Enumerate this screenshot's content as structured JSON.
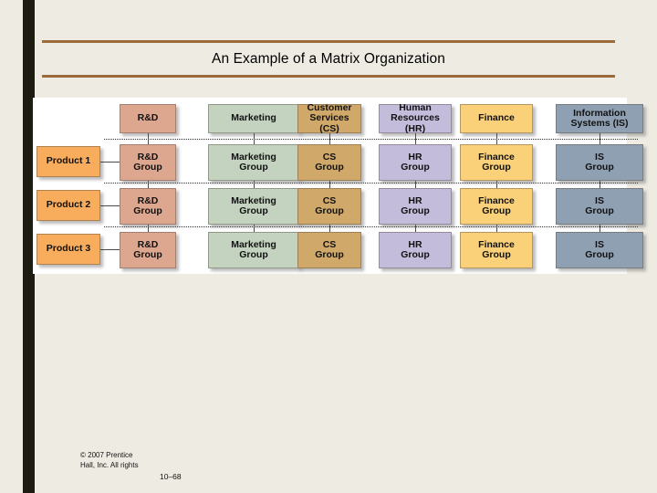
{
  "slide": {
    "title": "An Example of a Matrix Organization",
    "accent_rule_color": "#9c6b3c",
    "background_color": "#eeece2",
    "left_bar_color": "#1c1c10",
    "panel_color": "#ffffff"
  },
  "footer": {
    "copyright": "© 2007 Prentice Hall, Inc. All rights",
    "slide_number": "10–68"
  },
  "matrix": {
    "columns": [
      {
        "id": "rd",
        "header": "R&D",
        "color": "#dda68f",
        "group": "R&D\nGroup",
        "group_line1": "R&D",
        "group_line2": "Group"
      },
      {
        "id": "marketing",
        "header": "Marketing",
        "color": "#c3d3bf",
        "group": "Marketing\nGroup",
        "group_line1": "Marketing",
        "group_line2": "Group"
      },
      {
        "id": "cs",
        "header": "Customer\nServices (CS)",
        "color": "#cfa86a",
        "group": "CS\nGroup",
        "group_line1": "CS",
        "group_line2": "Group"
      },
      {
        "id": "hr",
        "header": "Human\nResources (HR)",
        "color": "#c3bcda",
        "group": "HR\nGroup",
        "group_line1": "HR",
        "group_line2": "Group"
      },
      {
        "id": "finance",
        "header": "Finance",
        "color": "#fad179",
        "group": "Finance\nGroup",
        "group_line1": "Finance",
        "group_line2": "Group"
      },
      {
        "id": "is",
        "header": "Information\nSystems (IS)",
        "color": "#8fa0b3",
        "group": "IS\nGroup",
        "group_line1": "IS",
        "group_line2": "Group"
      }
    ],
    "rows": [
      {
        "id": "product1",
        "label": "Product 1",
        "color": "#f7ad5c"
      },
      {
        "id": "product2",
        "label": "Product 2",
        "color": "#f7ad5c"
      },
      {
        "id": "product3",
        "label": "Product 3",
        "color": "#f7ad5c"
      }
    ],
    "header_labels": {
      "rd_line1": "R&D",
      "marketing_line1": "Marketing",
      "cs_line1": "Customer",
      "cs_line2": "Services (CS)",
      "hr_line1": "Human",
      "hr_line2": "Resources (HR)",
      "finance_line1": "Finance",
      "is_line1": "Information",
      "is_line2": "Systems (IS)"
    }
  }
}
